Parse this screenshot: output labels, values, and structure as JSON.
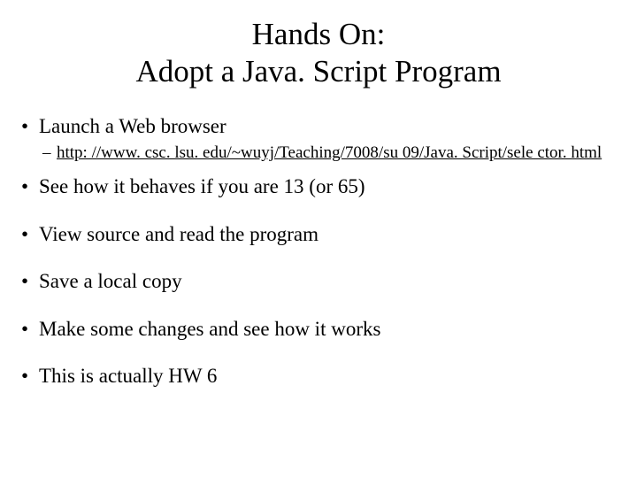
{
  "title_line1": "Hands On:",
  "title_line2": "Adopt a Java. Script Program",
  "bullets": {
    "b0": "Launch a Web browser",
    "sub0": "http: //www. csc. lsu. edu/~wuyj/Teaching/7008/su 09/Java. Script/sele ctor. html",
    "b1": "See how it behaves if you are 13 (or 65)",
    "b2": "View source and read the program",
    "b3": "Save a local copy",
    "b4": "Make some changes and see how it works",
    "b5": "This is actually HW 6"
  }
}
